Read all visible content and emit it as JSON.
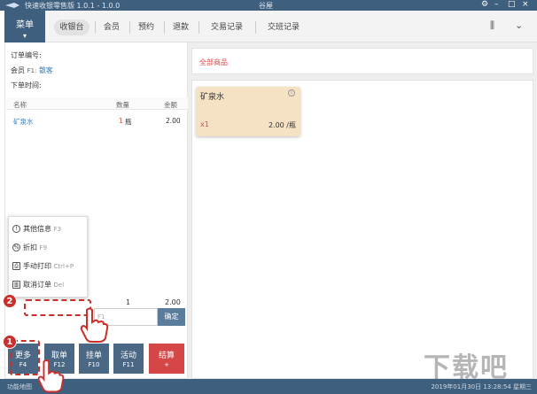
{
  "titlebar": {
    "app_title": "快速收银零售版 1.0.1 - 1.0.0",
    "shop_name": "谷屋",
    "settings_icon": "gear-icon",
    "minimize_icon": "minimize-icon",
    "maximize_icon": "maximize-icon",
    "close_icon": "close-icon"
  },
  "menu": {
    "label": "菜单",
    "icon": "chevron-down-icon"
  },
  "nav": {
    "tabs": [
      "收银台",
      "会员",
      "预约",
      "退款",
      "交易记录",
      "交班记录"
    ],
    "active_tab": "收银台",
    "right_icons": [
      "filter-icon",
      "chevron-down-icon"
    ]
  },
  "order": {
    "number_label": "订单编号:",
    "member_label": "会员",
    "member_key": "F1:",
    "member_value": "散客",
    "time_label": "下单时间:"
  },
  "list": {
    "headers": {
      "name": "名称",
      "qty": "数量",
      "amount": "金额"
    },
    "items": [
      {
        "name": "矿泉水",
        "qty": "1",
        "unit": "瓶",
        "amount": "2.00"
      }
    ]
  },
  "popup_menu": [
    {
      "label": "其他信息",
      "key": "F3",
      "icon": "info-icon"
    },
    {
      "label": "折扣",
      "key": "F9",
      "icon": "discount-icon"
    },
    {
      "label": "手动打印",
      "key": "Ctrl+P",
      "icon": "printer-icon"
    },
    {
      "label": "取消订单",
      "key": "Del",
      "icon": "trash-icon"
    }
  ],
  "summary": {
    "count": "1",
    "total": "2.00"
  },
  "code_input": {
    "placeholder": "F1"
  },
  "confirm_label": "确定",
  "bottom_buttons": [
    {
      "label": "更多",
      "key": "F4"
    },
    {
      "label": "取单",
      "key": "F12"
    },
    {
      "label": "挂单",
      "key": "F10"
    },
    {
      "label": "活动",
      "key": "F11"
    },
    {
      "label": "结算",
      "key": "+"
    }
  ],
  "category": {
    "label": "全部商品"
  },
  "products": [
    {
      "name": "矿泉水",
      "qty": "x1",
      "price": "2.00 /瓶"
    }
  ],
  "statusbar": {
    "left": "功能地图",
    "right": "2019年01月30日 13:28:54 星期三"
  },
  "annotations": [
    "1",
    "2"
  ],
  "watermark": "下载吧",
  "colors": {
    "title_bar": "#3f5f7e",
    "checkout": "#d54747",
    "product_card": "#f5e1c4",
    "annotation": "#c9302c"
  }
}
